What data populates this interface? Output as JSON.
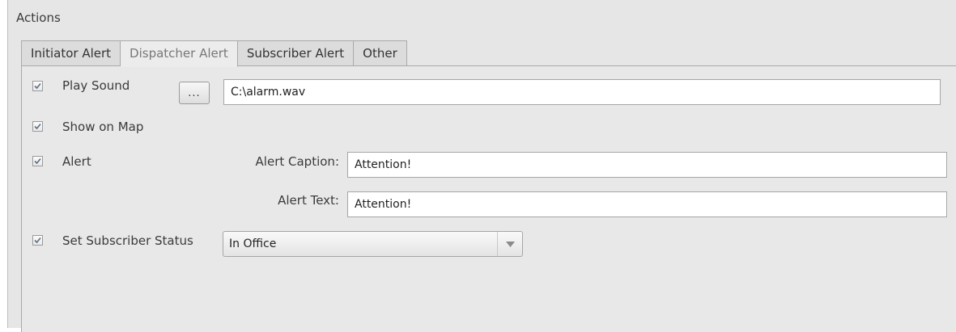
{
  "group_title": "Actions",
  "tabs": [
    {
      "label": "Initiator Alert",
      "active": false
    },
    {
      "label": "Dispatcher Alert",
      "active": true
    },
    {
      "label": "Subscriber Alert",
      "active": false
    },
    {
      "label": "Other",
      "active": false
    }
  ],
  "play_sound": {
    "label": "Play Sound",
    "checked": true,
    "browse_label": "...",
    "path": "C:\\alarm.wav"
  },
  "show_on_map": {
    "label": "Show on Map",
    "checked": true
  },
  "alert": {
    "label": "Alert",
    "checked": true,
    "caption_label": "Alert Caption:",
    "caption_value": "Attention!",
    "text_label": "Alert Text:",
    "text_value": "Attention!"
  },
  "subscriber_status": {
    "label": "Set Subscriber Status",
    "checked": true,
    "selected": "In Office"
  },
  "icons": {
    "checkbox_check": "check-icon",
    "dropdown": "chevron-down-icon"
  },
  "colors": {
    "panel_bg": "#e6e6e6",
    "border": "#a9a9a9",
    "check": "#5f6f86"
  }
}
